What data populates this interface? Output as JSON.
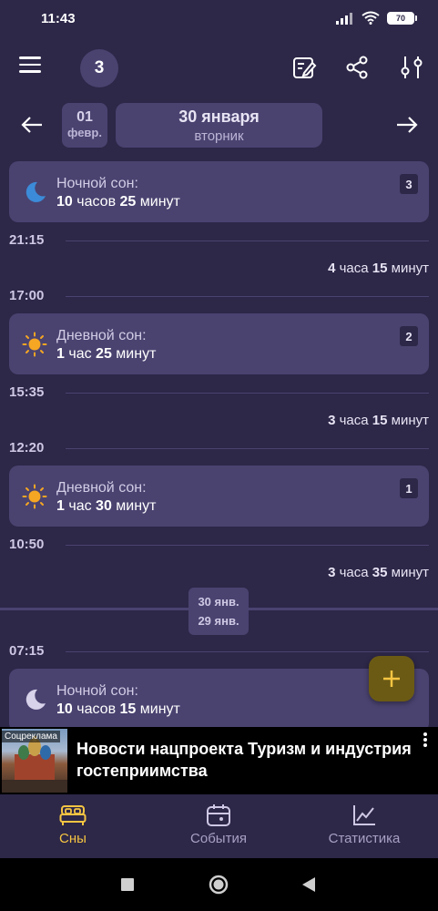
{
  "status": {
    "time": "11:43",
    "battery": "70"
  },
  "toolbar": {
    "count": "3"
  },
  "date_nav": {
    "prev_day": "01",
    "prev_month": "февр.",
    "current_date": "30 января",
    "current_weekday": "вторник"
  },
  "sleeps": [
    {
      "title": "Ночной сон:",
      "h": "10",
      "h_unit": "часов",
      "m": "25",
      "m_unit": "минут",
      "num": "3",
      "icon": "moon-icon"
    },
    {
      "title": "Дневной сон:",
      "h": "1",
      "h_unit": "час",
      "m": "25",
      "m_unit": "минут",
      "num": "2",
      "icon": "sun-icon"
    },
    {
      "title": "Дневной сон:",
      "h": "1",
      "h_unit": "час",
      "m": "30",
      "m_unit": "минут",
      "num": "1",
      "icon": "sun-icon"
    },
    {
      "title": "Ночной сон:",
      "h": "10",
      "h_unit": "часов",
      "m": "15",
      "m_unit": "минут",
      "icon": "moon-icon"
    }
  ],
  "times": [
    "21:15",
    "17:00",
    "15:35",
    "12:20",
    "10:50",
    "07:15"
  ],
  "awake": [
    {
      "h": "4",
      "h_unit": "часа",
      "m": "15",
      "m_unit": "минут"
    },
    {
      "h": "3",
      "h_unit": "часа",
      "m": "15",
      "m_unit": "минут"
    },
    {
      "h": "3",
      "h_unit": "часа",
      "m": "35",
      "m_unit": "минут"
    }
  ],
  "day_separator": {
    "top": "30 янв.",
    "bottom": "29 янв."
  },
  "ad": {
    "tag": "Соцреклама",
    "text": "Новости нацпроекта Туризм и индустрия гостеприимства"
  },
  "bottom_nav": [
    {
      "label": "Сны",
      "active": true
    },
    {
      "label": "События",
      "active": false
    },
    {
      "label": "Статистика",
      "active": false
    }
  ],
  "colors": {
    "background": "#2d2748",
    "card": "#4a4370",
    "accent": "#f5c542",
    "fab": "#6b5a14"
  }
}
